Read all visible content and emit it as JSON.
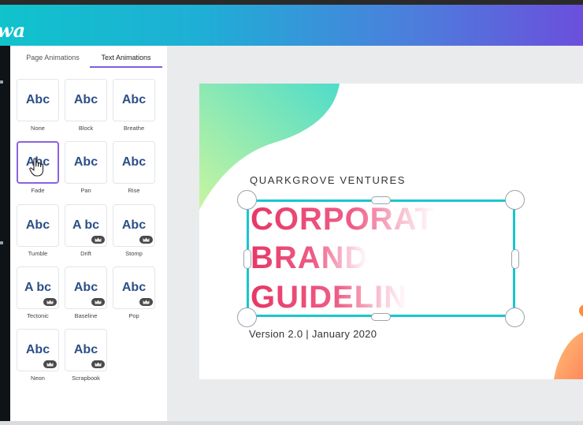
{
  "app": {
    "logo_text": "wa"
  },
  "panel": {
    "tabs": [
      {
        "label": "Page Animations",
        "active": false
      },
      {
        "label": "Text Animations",
        "active": true
      }
    ],
    "animations": [
      {
        "preview": "Abc",
        "label": "None",
        "premium": false,
        "selected": false
      },
      {
        "preview": "Abc",
        "label": "Block",
        "premium": false,
        "selected": false
      },
      {
        "preview": "Abc",
        "label": "Breathe",
        "premium": false,
        "selected": false
      },
      {
        "preview": "Abc",
        "label": "Fade",
        "premium": false,
        "selected": true
      },
      {
        "preview": "Abc",
        "label": "Pan",
        "premium": false,
        "selected": false
      },
      {
        "preview": "Abc",
        "label": "Rise",
        "premium": false,
        "selected": false
      },
      {
        "preview": "Abc",
        "label": "Tumble",
        "premium": false,
        "selected": false
      },
      {
        "preview": "A bc",
        "label": "Drift",
        "premium": true,
        "selected": false
      },
      {
        "preview": "Abc",
        "label": "Stomp",
        "premium": true,
        "selected": false
      },
      {
        "preview": "A bc",
        "label": "Tectonic",
        "premium": true,
        "selected": false
      },
      {
        "preview": "Abc",
        "label": "Baseline",
        "premium": true,
        "selected": false
      },
      {
        "preview": "Abc",
        "label": "Pop",
        "premium": true,
        "selected": false
      },
      {
        "preview": "Abc",
        "label": "Neon",
        "premium": true,
        "selected": false
      },
      {
        "preview": "Abc",
        "label": "Scrapbook",
        "premium": true,
        "selected": false
      }
    ]
  },
  "slide": {
    "company": "QUARKGROVE VENTURES",
    "title_lines": [
      "CORPORAT",
      "BRAND",
      "GUIDELIN"
    ],
    "version": "Version 2.0 | January 2020"
  },
  "colors": {
    "accent_purple": "#7d5fe0",
    "selection_teal": "#18c6cf",
    "title_pink": "#e73766",
    "preview_blue": "#2c4f86"
  },
  "icons": {
    "cursor": "hand-pointer-icon",
    "premium": "crown-icon"
  }
}
